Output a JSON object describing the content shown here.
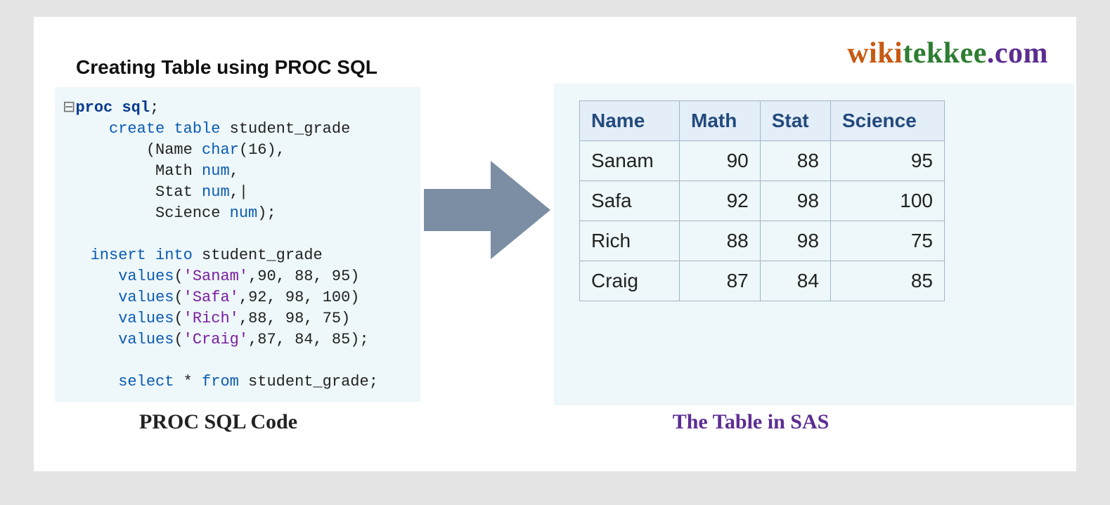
{
  "brand": {
    "part1": "wiki",
    "part2": "tekkee",
    "part3": ".com"
  },
  "title": "Creating Table using PROC SQL",
  "captions": {
    "left": "PROC SQL Code",
    "right": "The Table in SAS"
  },
  "code": {
    "l1_toggle": "⊟",
    "l1a": "proc",
    "l1b": " sql",
    "l1c": ";",
    "l2a": "     ",
    "l2b": "create",
    "l2c": " ",
    "l2d": "table",
    "l2e": " student_grade",
    "l3a": "         (Name ",
    "l3b": "char",
    "l3c": "(",
    "l3d": "16",
    "l3e": "),",
    "l4a": "          Math ",
    "l4b": "num",
    "l4c": ",",
    "l5a": "          Stat ",
    "l5b": "num",
    "l5c": ",",
    "l5cur": "|",
    "l6a": "          Science ",
    "l6b": "num",
    "l6c": ");",
    "l8a": "   ",
    "l8b": "insert",
    "l8c": " ",
    "l8d": "into",
    "l8e": " student_grade",
    "l9a": "      ",
    "l9b": "values",
    "l9c": "(",
    "l9d": "'Sanam'",
    "l9e": ",",
    "l9f": "90",
    "l9g": ", ",
    "l9h": "88",
    "l9i": ", ",
    "l9j": "95",
    "l9k": ")",
    "l10a": "      ",
    "l10b": "values",
    "l10c": "(",
    "l10d": "'Safa'",
    "l10e": ",",
    "l10f": "92",
    "l10g": ", ",
    "l10h": "98",
    "l10i": ", ",
    "l10j": "100",
    "l10k": ")",
    "l11a": "      ",
    "l11b": "values",
    "l11c": "(",
    "l11d": "'Rich'",
    "l11e": ",",
    "l11f": "88",
    "l11g": ", ",
    "l11h": "98",
    "l11i": ", ",
    "l11j": "75",
    "l11k": ")",
    "l12a": "      ",
    "l12b": "values",
    "l12c": "(",
    "l12d": "'Craig'",
    "l12e": ",",
    "l12f": "87",
    "l12g": ", ",
    "l12h": "84",
    "l12i": ", ",
    "l12j": "85",
    "l12k": ");",
    "l14a": "      ",
    "l14b": "select",
    "l14c": " * ",
    "l14d": "from",
    "l14e": " student_grade;"
  },
  "table": {
    "headers": [
      "Name",
      "Math",
      "Stat",
      "Science"
    ],
    "rows": [
      {
        "name": "Sanam",
        "math": "90",
        "stat": "88",
        "science": "95"
      },
      {
        "name": "Safa",
        "math": "92",
        "stat": "98",
        "science": "100"
      },
      {
        "name": "Rich",
        "math": "88",
        "stat": "98",
        "science": "75"
      },
      {
        "name": "Craig",
        "math": "87",
        "stat": "84",
        "science": "85"
      }
    ]
  }
}
